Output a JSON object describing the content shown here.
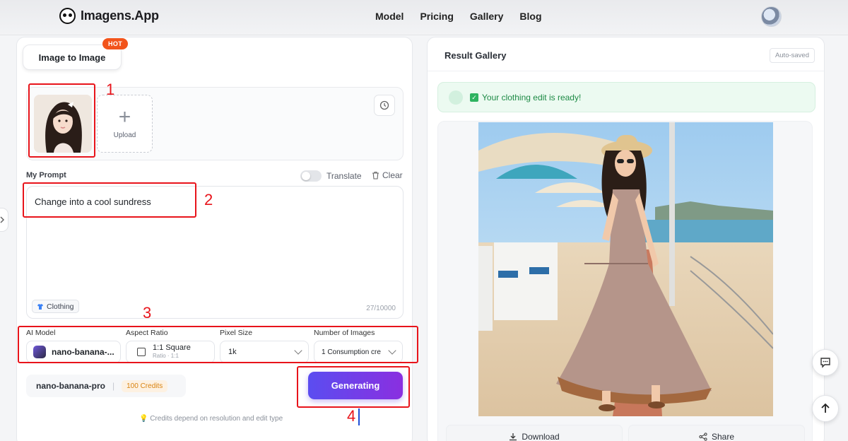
{
  "brand": {
    "name": "Imagens.App",
    "icon": "panda-logo-icon"
  },
  "nav": {
    "items": [
      "Model",
      "Pricing",
      "Gallery",
      "Blog"
    ]
  },
  "left": {
    "tab_label": "Image to Image",
    "hot_badge": "HOT",
    "upload_label": "Upload",
    "prompt_label": "My Prompt",
    "translate_label": "Translate",
    "clear_label": "Clear",
    "prompt_text": "Change into a cool sundress",
    "chip_label": "Clothing",
    "char_counter": "27/10000",
    "settings": {
      "ai_model": {
        "label": "AI Model",
        "value": "nano-banana-..."
      },
      "aspect_ratio": {
        "label": "Aspect Ratio",
        "value": "1:1 Square",
        "sub": "Ratio · 1:1"
      },
      "pixel_size": {
        "label": "Pixel Size",
        "value": "1k"
      },
      "num_images": {
        "label": "Number of Images",
        "value": "1 Consumption cre"
      }
    },
    "info_model": "nano-banana-pro",
    "info_sep": "|",
    "credits": "100 Credits",
    "generate_label": "Generating",
    "credit_note": "💡 Credits depend on resolution and edit type"
  },
  "right": {
    "title": "Result Gallery",
    "autosave": "Auto-saved",
    "ready_check": "✓",
    "ready_text": "Your clothing edit is ready!",
    "download_label": "Download",
    "share_label": "Share"
  },
  "annotations": {
    "n1": "1",
    "n2": "2",
    "n3": "3",
    "n4": "4"
  },
  "colors": {
    "accent_start": "#5b4df0",
    "accent_end": "#8a2fe0",
    "annotation": "#e8141b",
    "hot": "#f2541b",
    "success": "#1d8a45"
  }
}
